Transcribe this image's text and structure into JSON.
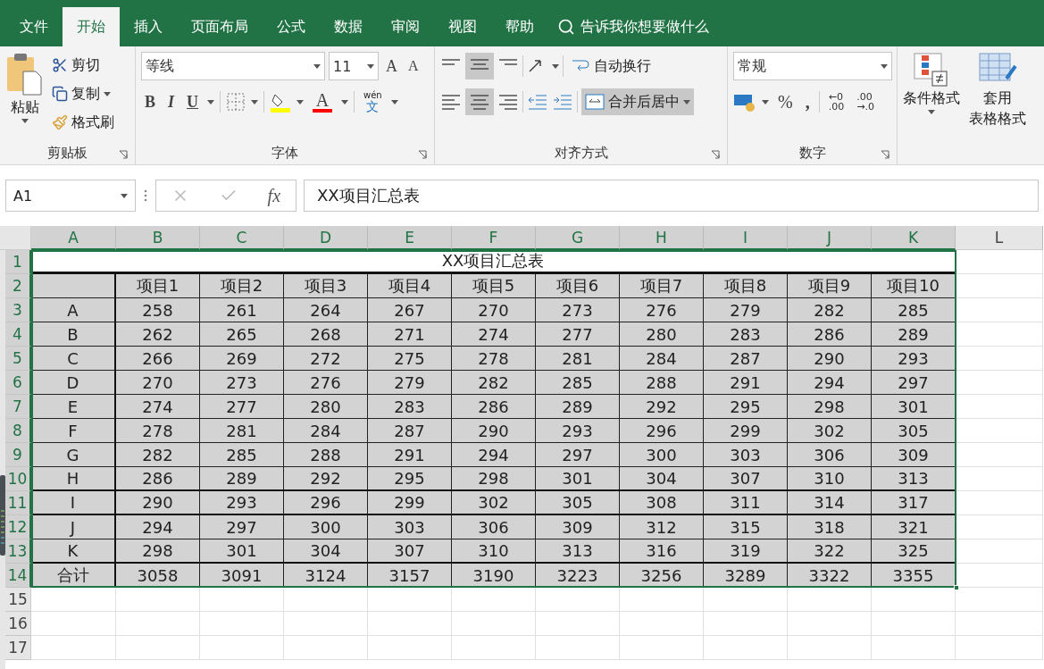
{
  "tabs": [
    {
      "label": "文件",
      "selected": false
    },
    {
      "label": "开始",
      "selected": true
    },
    {
      "label": "插入",
      "selected": false
    },
    {
      "label": "页面布局",
      "selected": false
    },
    {
      "label": "公式",
      "selected": false
    },
    {
      "label": "数据",
      "selected": false
    },
    {
      "label": "审阅",
      "selected": false
    },
    {
      "label": "视图",
      "selected": false
    },
    {
      "label": "帮助",
      "selected": false
    }
  ],
  "tell_me": {
    "placeholder": "告诉我你想要做什么"
  },
  "ribbon": {
    "clipboard": {
      "paste": "粘贴",
      "cut": "剪切",
      "copy": "复制",
      "format_painter": "格式刷",
      "label": "剪贴板"
    },
    "font": {
      "name": "等线",
      "size": "11",
      "grow": "A",
      "shrink": "A",
      "bold": "B",
      "italic": "I",
      "underline": "U",
      "font_color": "A",
      "phonetic_top": "wén",
      "phonetic_bottom": "文",
      "label": "字体"
    },
    "alignment": {
      "wrap": "自动换行",
      "merge": "合并后居中",
      "label": "对齐方式"
    },
    "number": {
      "format": "常规",
      "percent": "%",
      "comma": ",",
      "increase_decimal": [
        "←0",
        ".00"
      ],
      "decrease_decimal": [
        ".00",
        "→.0"
      ],
      "label": "数字"
    },
    "styles": {
      "conditional": "条件格式",
      "table_top": "套用",
      "table_bottom": "表格格式"
    }
  },
  "formula_bar": {
    "name_box": "A1",
    "fx": "fx",
    "content": "XX项目汇总表"
  },
  "sheet": {
    "columns": [
      {
        "label": "A",
        "selected": true
      },
      {
        "label": "B",
        "selected": true
      },
      {
        "label": "C",
        "selected": true
      },
      {
        "label": "D",
        "selected": true
      },
      {
        "label": "E",
        "selected": true
      },
      {
        "label": "F",
        "selected": true
      },
      {
        "label": "G",
        "selected": true
      },
      {
        "label": "H",
        "selected": true
      },
      {
        "label": "I",
        "selected": true
      },
      {
        "label": "J",
        "selected": true
      },
      {
        "label": "K",
        "selected": true
      },
      {
        "label": "L",
        "selected": false
      }
    ],
    "row_numbers": [
      {
        "label": "1",
        "selected": true
      },
      {
        "label": "2",
        "selected": true
      },
      {
        "label": "3",
        "selected": true
      },
      {
        "label": "4",
        "selected": true
      },
      {
        "label": "5",
        "selected": true
      },
      {
        "label": "6",
        "selected": true
      },
      {
        "label": "7",
        "selected": true
      },
      {
        "label": "8",
        "selected": true
      },
      {
        "label": "9",
        "selected": true
      },
      {
        "label": "10",
        "selected": true
      },
      {
        "label": "11",
        "selected": true
      },
      {
        "label": "12",
        "selected": true
      },
      {
        "label": "13",
        "selected": true
      },
      {
        "label": "14",
        "selected": true
      },
      {
        "label": "15",
        "selected": false
      },
      {
        "label": "16",
        "selected": false
      },
      {
        "label": "17",
        "selected": false
      }
    ],
    "title": "XX项目汇总表",
    "header": [
      "项目1",
      "项目2",
      "项目3",
      "项目4",
      "项目5",
      "项目6",
      "项目7",
      "项目8",
      "项目9",
      "项目10"
    ],
    "rows": [
      {
        "label": "A",
        "values": [
          "258",
          "261",
          "264",
          "267",
          "270",
          "273",
          "276",
          "279",
          "282",
          "285"
        ]
      },
      {
        "label": "B",
        "values": [
          "262",
          "265",
          "268",
          "271",
          "274",
          "277",
          "280",
          "283",
          "286",
          "289"
        ]
      },
      {
        "label": "C",
        "values": [
          "266",
          "269",
          "272",
          "275",
          "278",
          "281",
          "284",
          "287",
          "290",
          "293"
        ]
      },
      {
        "label": "D",
        "values": [
          "270",
          "273",
          "276",
          "279",
          "282",
          "285",
          "288",
          "291",
          "294",
          "297"
        ]
      },
      {
        "label": "E",
        "values": [
          "274",
          "277",
          "280",
          "283",
          "286",
          "289",
          "292",
          "295",
          "298",
          "301"
        ]
      },
      {
        "label": "F",
        "values": [
          "278",
          "281",
          "284",
          "287",
          "290",
          "293",
          "296",
          "299",
          "302",
          "305"
        ]
      },
      {
        "label": "G",
        "values": [
          "282",
          "285",
          "288",
          "291",
          "294",
          "297",
          "300",
          "303",
          "306",
          "309"
        ]
      },
      {
        "label": "H",
        "values": [
          "286",
          "289",
          "292",
          "295",
          "298",
          "301",
          "304",
          "307",
          "310",
          "313"
        ]
      },
      {
        "label": "I",
        "values": [
          "290",
          "293",
          "296",
          "299",
          "302",
          "305",
          "308",
          "311",
          "314",
          "317"
        ]
      },
      {
        "label": "J",
        "values": [
          "294",
          "297",
          "300",
          "303",
          "306",
          "309",
          "312",
          "315",
          "318",
          "321"
        ]
      },
      {
        "label": "K",
        "values": [
          "298",
          "301",
          "304",
          "307",
          "310",
          "313",
          "316",
          "319",
          "322",
          "325"
        ]
      },
      {
        "label": "合计",
        "values": [
          "3058",
          "3091",
          "3124",
          "3157",
          "3190",
          "3223",
          "3256",
          "3289",
          "3322",
          "3355"
        ]
      }
    ]
  }
}
